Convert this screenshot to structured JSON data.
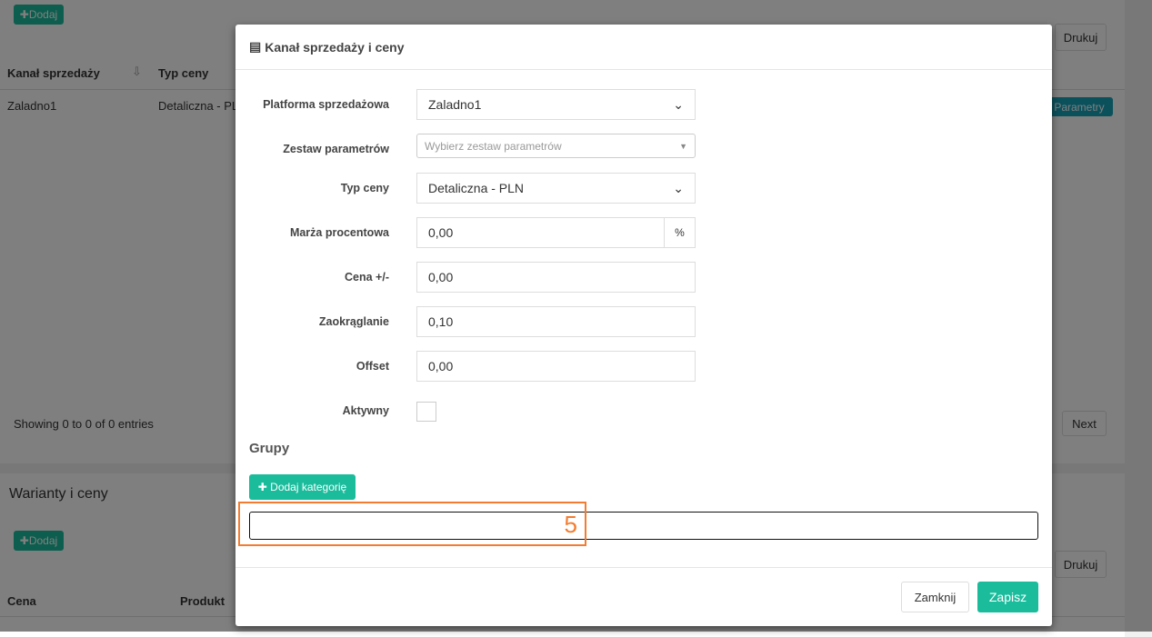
{
  "background": {
    "add_label": "Dodaj",
    "print_label": "Drukuj",
    "table1": {
      "headers": [
        "Kanał sprzedaży",
        "Typ ceny"
      ],
      "row": [
        "Zaladno1",
        "Detaliczna - PL"
      ],
      "params_label": "Parametry"
    },
    "showing": "Showing 0 to 0 of 0 entries",
    "next_label": "Next",
    "panel2_title": "Warianty i ceny",
    "add2_label": "Dodaj",
    "print2_label": "Drukuj",
    "table2": {
      "headers": [
        "Cena",
        "Produkt"
      ]
    }
  },
  "modal": {
    "title": "Kanał sprzedaży i ceny",
    "fields": [
      {
        "label": "Platforma sprzedażowa",
        "value": "Zaladno1"
      },
      {
        "label": "Zestaw parametrów",
        "placeholder": "Wybierz zestaw parametrów"
      },
      {
        "label": "Typ ceny",
        "value": "Detaliczna - PLN"
      },
      {
        "label": "Marża procentowa",
        "value": "0,00",
        "addon": "%"
      },
      {
        "label": "Cena +/-",
        "value": "0,00"
      },
      {
        "label": "Zaokrąglanie",
        "value": "0,10"
      },
      {
        "label": "Offset",
        "value": "0,00"
      },
      {
        "label": "Aktywny",
        "checked": false
      }
    ],
    "groups_title": "Grupy",
    "add_category_label": "Dodaj kategorię",
    "annotation": "5",
    "close_label": "Zamknij",
    "save_label": "Zapisz"
  },
  "colors": {
    "accent": "#1abc9c",
    "annotation": "#f47c30"
  }
}
